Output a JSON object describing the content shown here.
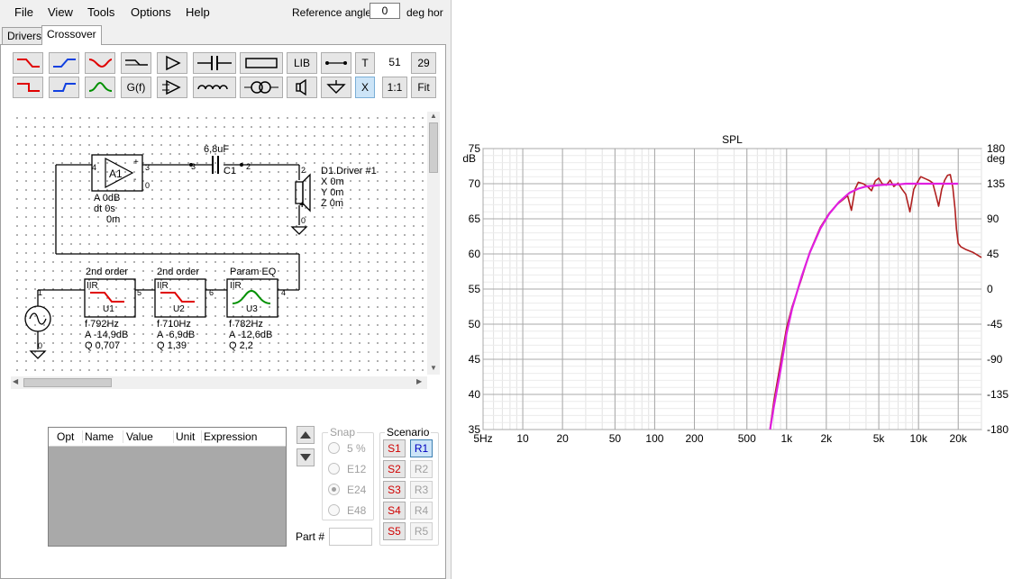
{
  "menu": {
    "items": [
      "File",
      "View",
      "Tools",
      "Options",
      "Help"
    ]
  },
  "reference": {
    "label": "Reference angle",
    "value": "0",
    "unit": "deg hor"
  },
  "tabs": [
    {
      "label": "Drivers",
      "active": false
    },
    {
      "label": "Crossover",
      "active": true
    }
  ],
  "toolbar": {
    "lib_label": "LIB",
    "t_label": "T",
    "x_label": "X",
    "gf_label": "G(f)",
    "count1": "51",
    "count2": "29",
    "ratio_label": "1:1",
    "fit_label": "Fit",
    "row1_icons": [
      "highpass-red-icon",
      "lowpass-blue-icon",
      "bandpass-red-icon",
      "allpass-icon",
      "amplifier-icon",
      "capacitor-icon",
      "resistor-icon"
    ],
    "row2_icons": [
      "highpass2-red-icon",
      "lowpass2-blue-icon",
      "parametric-eq-icon",
      "delay-amplifier-icon",
      "inductor-icon",
      "transformer-icon",
      "speaker-icon",
      "ground-icon"
    ]
  },
  "schematic": {
    "amp": {
      "name": "A1",
      "gain": "A  0dB",
      "delay": "dt 0s",
      "offset": "0m",
      "node_in": "4",
      "node_out": "3",
      "node_gnd": "0"
    },
    "capacitor": {
      "name": "C1",
      "value": "6,8uF",
      "node_a": "3",
      "node_b": "2"
    },
    "driver": {
      "name": "D1.Driver #1",
      "x": "X 0m",
      "y": "Y 0m",
      "z": "Z 0m",
      "node_top": "2",
      "node_bottom": "0"
    },
    "source": {
      "node_top": "1",
      "node_bottom": "0"
    },
    "filters": [
      {
        "header": "2nd order",
        "type": "IIR",
        "name": "U1",
        "f": "f  792Hz",
        "a": "A  -14,9dB",
        "q": "Q  0,707",
        "node_in": "1",
        "node_out": "5",
        "curve_color": "#e00000"
      },
      {
        "header": "2nd order",
        "type": "IIR",
        "name": "U2",
        "f": "f  710Hz",
        "a": "A  -6,9dB",
        "q": "Q  1,39",
        "node_in": "5",
        "node_out": "6",
        "curve_color": "#e00000"
      },
      {
        "header": "Param EQ",
        "type": "IIR",
        "name": "U3",
        "f": "f  782Hz",
        "a": "A  -12,6dB",
        "q": "Q  2,2",
        "node_in": "6",
        "node_out": "4",
        "curve_color": "#009000"
      }
    ],
    "gnd_node": "0"
  },
  "parts_table": {
    "columns": [
      "Opt",
      "Name",
      "Value",
      "Unit",
      "Expression"
    ]
  },
  "snap": {
    "title": "Snap",
    "options": [
      "5 %",
      "E12",
      "E24",
      "E48"
    ],
    "selected": "E24"
  },
  "scenario": {
    "title": "Scenario",
    "s_buttons": [
      "S1",
      "S2",
      "S3",
      "S4",
      "S5"
    ],
    "r_buttons": [
      "R1",
      "R2",
      "R3",
      "R4",
      "R5"
    ],
    "active_r": "R1"
  },
  "part_number": {
    "label": "Part #",
    "value": ""
  },
  "chart_data": {
    "type": "line",
    "title": "SPL",
    "xscale": "log",
    "xlim": [
      5,
      30000
    ],
    "ylim": [
      35,
      75
    ],
    "y2lim": [
      -180,
      180
    ],
    "ylabel": "dB",
    "y2label": "deg",
    "x_ticks": [
      {
        "v": 5,
        "label": "5Hz"
      },
      {
        "v": 10,
        "label": "10"
      },
      {
        "v": 20,
        "label": "20"
      },
      {
        "v": 50,
        "label": "50"
      },
      {
        "v": 100,
        "label": "100"
      },
      {
        "v": 200,
        "label": "200"
      },
      {
        "v": 500,
        "label": "500"
      },
      {
        "v": 1000,
        "label": "1k"
      },
      {
        "v": 2000,
        "label": "2k"
      },
      {
        "v": 5000,
        "label": "5k"
      },
      {
        "v": 10000,
        "label": "10k"
      },
      {
        "v": 20000,
        "label": "20k"
      }
    ],
    "y_ticks": [
      35,
      40,
      45,
      50,
      55,
      60,
      65,
      70,
      75
    ],
    "y2_ticks": [
      "-180",
      "-135",
      "-90",
      "-45",
      "0",
      "45",
      "90",
      "135",
      "180"
    ],
    "grid": true,
    "series": [
      {
        "color": "#b02020",
        "x": [
          750,
          800,
          900,
          1000,
          1100,
          1300,
          1500,
          1800,
          2100,
          2400,
          2700,
          2900,
          3100,
          3300,
          3500,
          3800,
          4100,
          4400,
          4700,
          5000,
          5300,
          5700,
          6100,
          6500,
          7000,
          7500,
          8000,
          8600,
          9200,
          9800,
          10400,
          11000,
          11600,
          12200,
          12800,
          13500,
          14200,
          15000,
          15800,
          16600,
          17400,
          18200,
          18900,
          19400,
          20000,
          21000,
          23000,
          26000,
          30000
        ],
        "y": [
          35.2,
          39,
          44.5,
          49.5,
          52.5,
          56.5,
          60.3,
          63.8,
          65.8,
          67,
          67.8,
          68.3,
          66.2,
          69.2,
          70.2,
          70,
          69.6,
          69,
          70.4,
          70.8,
          70,
          69.8,
          70.5,
          69.6,
          70.1,
          69.2,
          68.5,
          66,
          69.2,
          70.2,
          71,
          70.8,
          70.6,
          70.4,
          70.1,
          68.5,
          66.8,
          69.2,
          70.5,
          71.2,
          71.3,
          69.5,
          66.5,
          63.5,
          61.5,
          61,
          60.6,
          60.2,
          59.5
        ]
      },
      {
        "color": "#e020e0",
        "x": [
          750,
          800,
          900,
          1000,
          1100,
          1300,
          1500,
          1800,
          2100,
          2500,
          3000,
          3500,
          4000,
          5000,
          6000,
          7000,
          8000,
          10000,
          12000,
          15000,
          18000,
          20000
        ],
        "y": [
          35,
          38.2,
          43.5,
          48.7,
          52.2,
          56.8,
          60.2,
          63.6,
          65.7,
          67.4,
          68.7,
          69.3,
          69.6,
          69.8,
          69.9,
          69.9,
          70,
          70,
          70,
          70,
          70,
          70
        ]
      }
    ]
  }
}
